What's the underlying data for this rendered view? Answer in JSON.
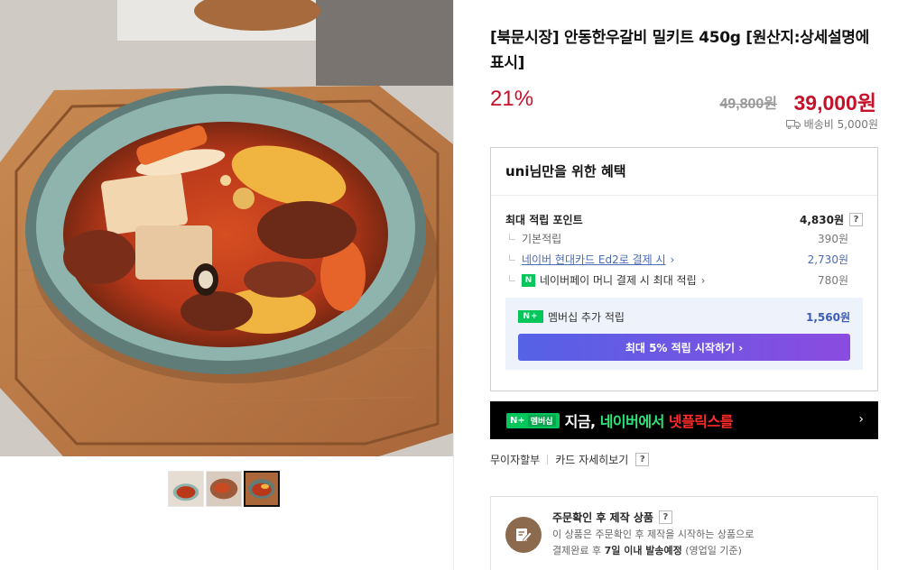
{
  "product": {
    "title": "[북문시장] 안동한우갈비 밀키트 450g [원산지:상세설명에 표시]",
    "discount": "21%",
    "original_price": "49,800원",
    "sale_price": "39,000원",
    "shipping": "배송비 5,000원"
  },
  "gallery": {
    "main_image": "braised-beef-rib-stew-photo",
    "thumbnails": [
      "thumb-1",
      "thumb-2",
      "thumb-3"
    ],
    "active_thumb": 3
  },
  "benefits": {
    "header": "uni님만을 위한 혜택",
    "max_points_label": "최대 적립 포인트",
    "max_points_value": "4,830원",
    "help": "?",
    "items": [
      {
        "label": "기본적립",
        "value": "390원"
      },
      {
        "label": "네이버 현대카드 Ed2로 결제 시",
        "value": "2,730원"
      },
      {
        "label": "네이버페이 머니 결제 시 최대 적립",
        "value": "780원"
      }
    ],
    "membership": {
      "badge": "N+",
      "label": "멤버십 추가 적립",
      "value": "1,560원",
      "button": "최대 5% 적립 시작하기"
    }
  },
  "banner": {
    "badge_n": "N+",
    "badge_m": "멤버십",
    "text_a": "지금, ",
    "text_b": "네이버에서 ",
    "text_c": "넷플릭스를"
  },
  "payment": {
    "installment": "무이자할부",
    "card_detail": "카드 자세히보기",
    "help": "?"
  },
  "made_to_order": {
    "title": "주문확인 후 제작 상품",
    "help": "?",
    "line1": "이 상품은 주문확인 후 제작을 시작하는 상품으로",
    "line2_a": "결제완료 후 ",
    "line2_b": "7일 이내 발송예정",
    "line2_c": " (영업일 기준)"
  },
  "colors": {
    "sale_red": "#c6112b",
    "naver_green": "#03c75a",
    "button_gradient_start": "#5462e6",
    "button_gradient_end": "#8b4be0"
  }
}
